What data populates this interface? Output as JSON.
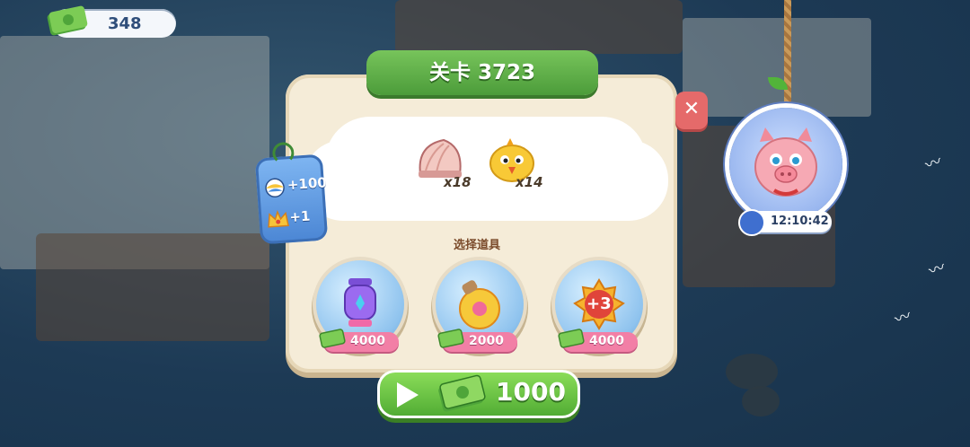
{
  "level": {
    "title": "关卡 3723"
  },
  "currency": {
    "amount": "348",
    "icon": "cash-icon"
  },
  "goals": [
    {
      "icon": "shell-icon",
      "count": "x18"
    },
    {
      "icon": "chick-icon",
      "count": "x14"
    }
  ],
  "rewards": [
    {
      "icon": "beach-ball-icon",
      "value": "+100"
    },
    {
      "icon": "crown-icon",
      "value": "+1"
    }
  ],
  "boosters": {
    "label": "选择道具",
    "items": [
      {
        "icon": "lantern-icon",
        "price": "4000"
      },
      {
        "icon": "ornament-icon",
        "price": "2000"
      },
      {
        "icon": "plus-three-moves-icon",
        "badge": "+3",
        "price": "4000"
      }
    ]
  },
  "play": {
    "cost": "1000"
  },
  "timer": {
    "value": "12:10:42"
  },
  "colors": {
    "title_green": "#4c9c3a",
    "panel": "#f5ecd8",
    "price_pink": "#f27fa6",
    "close_red": "#e56a6a"
  }
}
